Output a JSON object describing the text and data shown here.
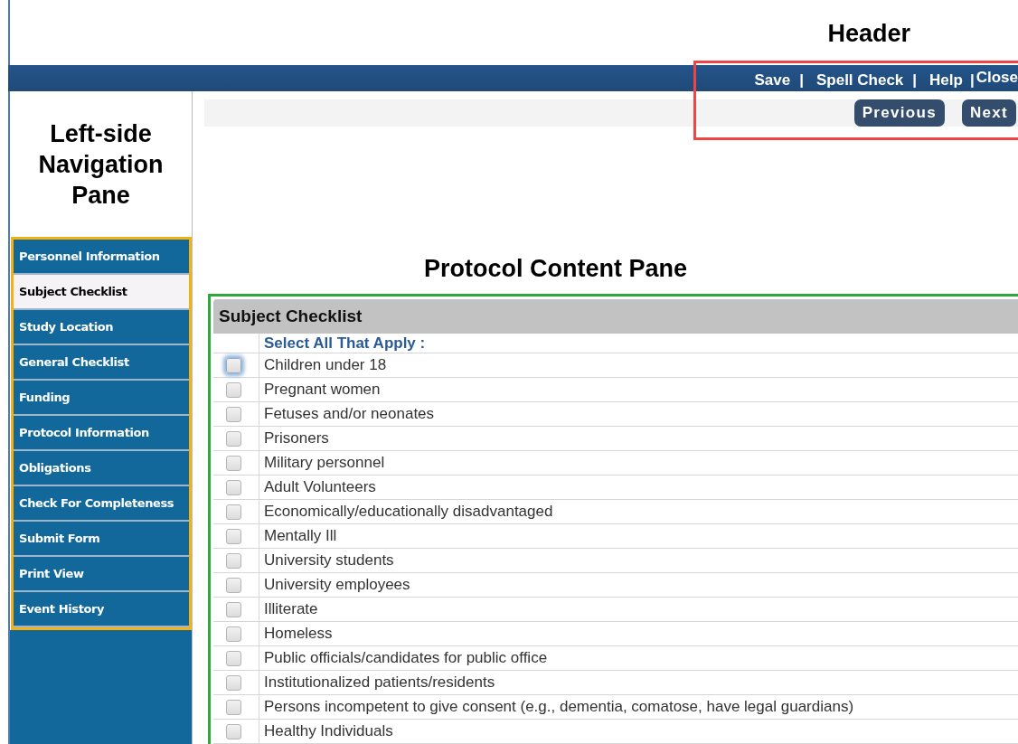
{
  "header": {
    "annotation": {
      "label": "Header",
      "color": "#f04444"
    },
    "links": [
      {
        "label": "Save",
        "separator": "|"
      },
      {
        "label": "Spell Check",
        "separator": "|"
      },
      {
        "label": "Help",
        "separator": "|"
      },
      {
        "label": "Close"
      }
    ],
    "buttons": [
      "Previous",
      "Next"
    ]
  },
  "sidebar": {
    "annotation": {
      "label": "Left-side Navigation Pane",
      "color": "#f5b10f"
    },
    "items": [
      {
        "label": "Personnel Information",
        "selected": false
      },
      {
        "label": "Subject Checklist",
        "selected": true
      },
      {
        "label": "Study Location",
        "selected": false
      },
      {
        "label": "General Checklist",
        "selected": false
      },
      {
        "label": "Funding",
        "selected": false
      },
      {
        "label": "Protocol Information",
        "selected": false
      },
      {
        "label": "Obligations",
        "selected": false
      },
      {
        "label": "Check For Completeness",
        "selected": false
      },
      {
        "label": "Submit Form",
        "selected": false
      },
      {
        "label": "Print View",
        "selected": false
      },
      {
        "label": "Event History",
        "selected": false
      }
    ]
  },
  "content": {
    "annotation": {
      "label": "Protocol Content Pane",
      "color": "#2ea83a"
    },
    "title": "Subject Checklist",
    "instruction": "Select All That Apply :",
    "options": [
      {
        "label": "Children under 18",
        "checked": false,
        "focused": true
      },
      {
        "label": "Pregnant women",
        "checked": false,
        "focused": false
      },
      {
        "label": "Fetuses and/or neonates",
        "checked": false,
        "focused": false
      },
      {
        "label": "Prisoners",
        "checked": false,
        "focused": false
      },
      {
        "label": "Military personnel",
        "checked": false,
        "focused": false
      },
      {
        "label": "Adult Volunteers",
        "checked": false,
        "focused": false
      },
      {
        "label": "Economically/educationally disadvantaged",
        "checked": false,
        "focused": false
      },
      {
        "label": "Mentally Ill",
        "checked": false,
        "focused": false
      },
      {
        "label": "University students",
        "checked": false,
        "focused": false
      },
      {
        "label": "University employees",
        "checked": false,
        "focused": false
      },
      {
        "label": "Illiterate",
        "checked": false,
        "focused": false
      },
      {
        "label": "Homeless",
        "checked": false,
        "focused": false
      },
      {
        "label": "Public officials/candidates for public office",
        "checked": false,
        "focused": false
      },
      {
        "label": "Institutionalized patients/residents",
        "checked": false,
        "focused": false
      },
      {
        "label": "Persons incompetent to give consent (e.g., dementia, comatose, have legal guardians)",
        "checked": false,
        "focused": false
      },
      {
        "label": "Healthy Individuals",
        "checked": false,
        "focused": false
      }
    ]
  }
}
